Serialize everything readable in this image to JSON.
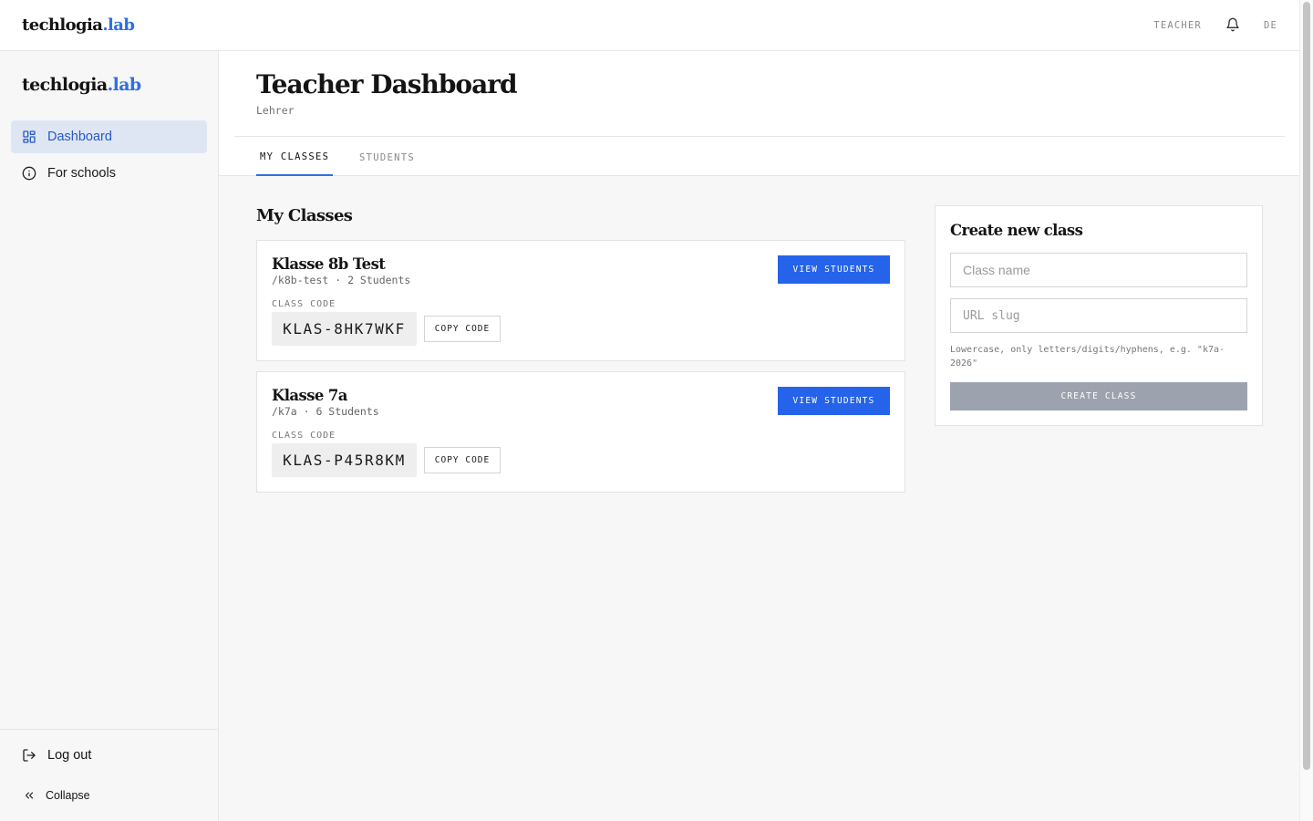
{
  "brand": {
    "name": "techlogia",
    "suffix": ".lab"
  },
  "topbar": {
    "role": "TEACHER",
    "language": "DE",
    "notifications_icon": "bell-icon"
  },
  "sidebar": {
    "items": [
      {
        "label": "Dashboard",
        "icon": "dashboard-icon",
        "active": true
      },
      {
        "label": "For schools",
        "icon": "info-icon",
        "active": false
      }
    ],
    "logout_label": "Log out",
    "collapse_label": "Collapse"
  },
  "header": {
    "title": "Teacher Dashboard",
    "subtitle": "Lehrer"
  },
  "tabs": [
    {
      "label": "MY CLASSES",
      "active": true
    },
    {
      "label": "STUDENTS",
      "active": false
    }
  ],
  "classes": {
    "title": "My Classes",
    "code_label": "CLASS CODE",
    "copy_label": "COPY CODE",
    "view_label": "VIEW STUDENTS",
    "items": [
      {
        "name": "Klasse 8b Test",
        "meta": "/k8b-test · 2 Students",
        "code": "KLAS-8HK7WKF"
      },
      {
        "name": "Klasse 7a",
        "meta": "/k7a · 6 Students",
        "code": "KLAS-P45R8KM"
      }
    ]
  },
  "create": {
    "title": "Create new class",
    "name_placeholder": "Class name",
    "slug_placeholder": "URL slug",
    "hint": "Lowercase, only letters/digits/hyphens, e.g. \"k7a-2026\"",
    "button_label": "CREATE CLASS"
  },
  "colors": {
    "accent": "#2563eb",
    "brand_accent": "#2f6fe0",
    "active_nav_bg": "#dfe6f3",
    "disabled_button": "#9ca3af"
  }
}
